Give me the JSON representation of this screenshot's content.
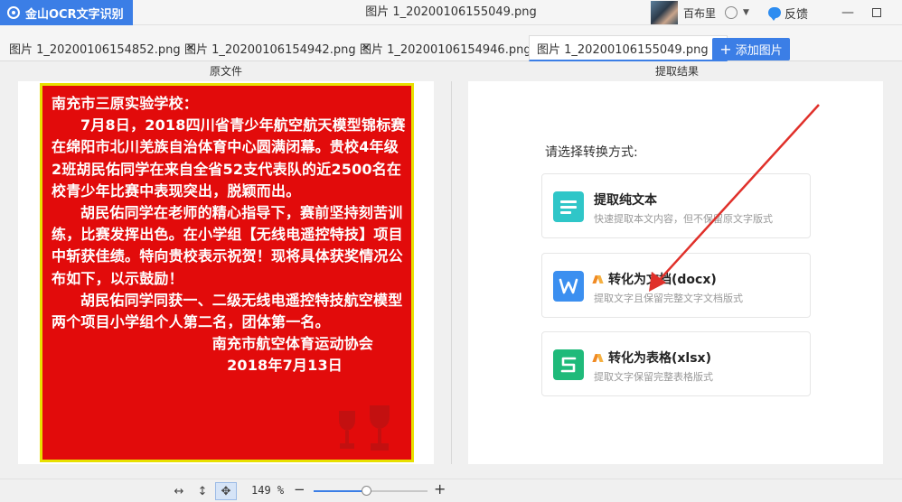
{
  "app": {
    "brand": "金山OCR文字识别",
    "window_title": "图片 1_20200106155049.png",
    "user_name": "百布里",
    "feedback": "反馈"
  },
  "tabs": [
    {
      "label": "图片 1_20200106154852.png",
      "active": false
    },
    {
      "label": "图片 1_20200106154942.png",
      "active": false
    },
    {
      "label": "图片 1_20200106154946.png",
      "active": false
    },
    {
      "label": "图片 1_20200106155049.png",
      "active": true
    }
  ],
  "add_image_label": "添加图片",
  "sections": {
    "original": "原文件",
    "result": "提取结果"
  },
  "poster": {
    "heading": "南充市三原实验学校：",
    "para1": "7月8日，2018四川省青少年航空航天模型锦标赛在绵阳市北川羌族自治体育中心圆满闭幕。贵校4年级2班胡民佑同学在来自全省52支代表队的近2500名在校青少年比赛中表现突出，脱颖而出。",
    "para2": "胡民佑同学在老师的精心指导下，赛前坚持刻苦训练，比赛发挥出色。在小学组【无线电遥控特技】项目中斩获佳绩。特向贵校表示祝贺！现将具体获奖情况公布如下，以示鼓励！",
    "para3": "胡民佑同学同获一、二级无线电遥控特技航空模型两个项目小学组个人第二名，团体第一名。",
    "signature": "南充市航空体育运动协会",
    "date": "2018年7月13日"
  },
  "convert": {
    "prompt": "请选择转换方式:",
    "options": [
      {
        "title": "提取纯文本",
        "desc": "快速提取本文内容，但不保留原文字版式",
        "icon": "text-lines-icon",
        "vip": false
      },
      {
        "title": "转化为文档(docx)",
        "desc": "提取文字且保留完整文字文档版式",
        "icon": "word-doc-icon",
        "vip": true
      },
      {
        "title": "转化为表格(xlsx)",
        "desc": "提取文字保留完整表格版式",
        "icon": "excel-sheet-icon",
        "vip": true
      }
    ]
  },
  "toolbar": {
    "zoom": "149 %",
    "zoom_minus": "−",
    "zoom_plus": "+",
    "zoom_fraction": 0.46
  },
  "colors": {
    "accent": "#3b7ee6",
    "poster_bg": "#e20b0b",
    "poster_border": "#e8e000",
    "arrow": "#e0302a"
  }
}
